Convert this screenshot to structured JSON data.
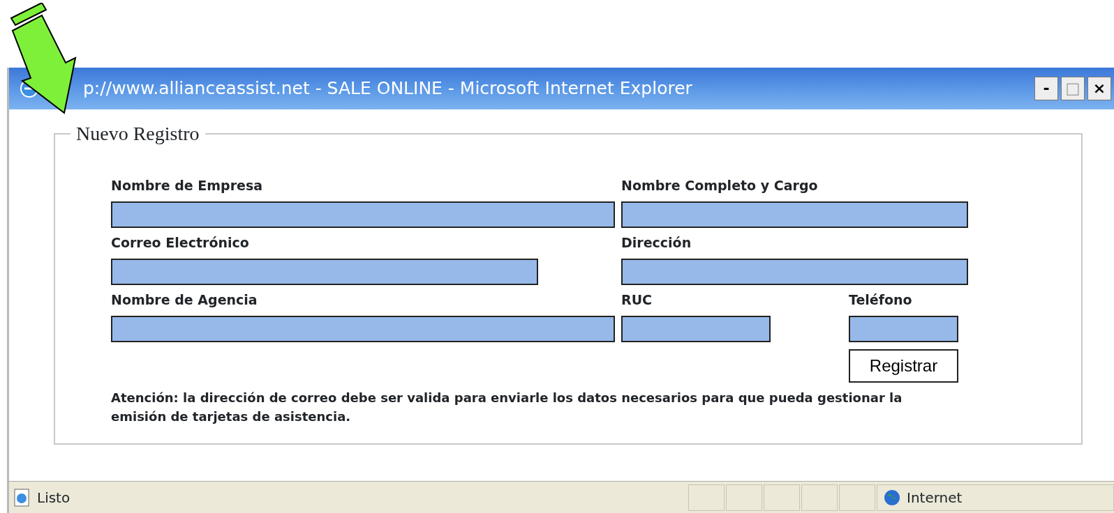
{
  "window": {
    "title": "p://www.allianceassist.net - SALE ONLINE - Microsoft Internet Explorer",
    "controls": [
      "-",
      "□",
      "×"
    ]
  },
  "form": {
    "legend": "Nuevo Registro",
    "fields": [
      {
        "label": "Nombre de Empresa"
      },
      {
        "label": "Nombre Completo y Cargo"
      },
      {
        "label": "Correo Electrónico"
      },
      {
        "label": "Dirección"
      },
      {
        "label": "Nombre de Agencia"
      },
      {
        "label": "RUC"
      },
      {
        "label": "Teléfono"
      }
    ],
    "submit": "Registrar",
    "notice": "Atención: la dirección de correo debe ser valida para enviarle los datos necesarios para que pueda gestionar la emisión de tarjetas de asistencia."
  },
  "status_bar": {
    "text": "Listo",
    "zone": "Internet"
  }
}
